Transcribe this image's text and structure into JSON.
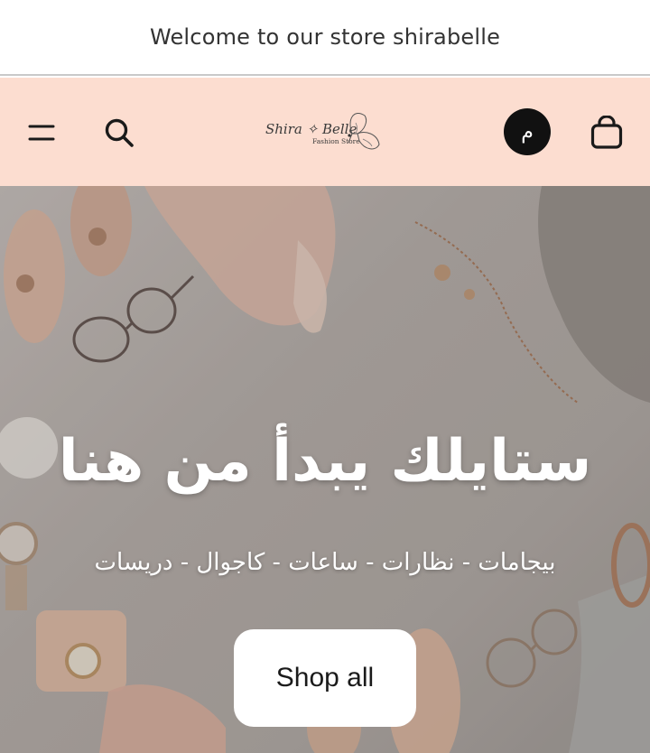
{
  "announcement": {
    "text": "Welcome to our store shirabelle"
  },
  "header": {
    "menu_icon": "hamburger-menu-icon",
    "search_icon": "search-icon",
    "logo": {
      "name": "Shira ✧ Belle",
      "tagline": "Fashion Store"
    },
    "language_label": "م",
    "cart_icon": "shopping-bag-icon"
  },
  "hero": {
    "title": "ستايلك يبدأ من هنا",
    "subtitle": "بيجامات - نظارات - ساعات - كاجوال - دريسات",
    "cta_label": "Shop all"
  },
  "colors": {
    "header_bg": "#fcddd0",
    "announcement_bg": "#ffffff",
    "lang_badge_bg": "#111111",
    "cta_bg": "#ffffff"
  }
}
